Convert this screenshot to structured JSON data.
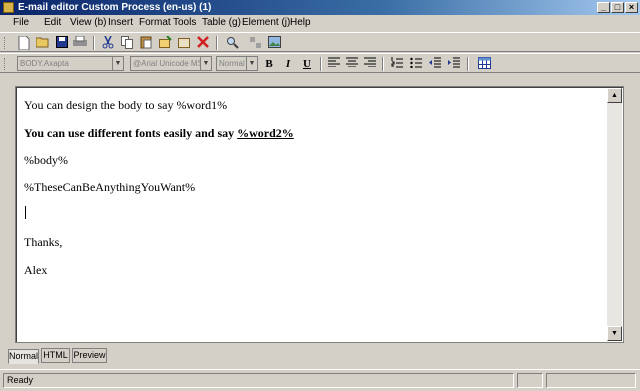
{
  "window": {
    "title": "E-mail editor Custom Process (en-us) (1)",
    "buttons": [
      "_",
      "□",
      "×"
    ]
  },
  "menu": [
    "File",
    "Edit",
    "View (b)",
    "Insert",
    "Format",
    "Tools",
    "Table (g)",
    "Element (j)",
    "Help"
  ],
  "toolbar1": {
    "icons": [
      "new-icon",
      "open-icon",
      "save-icon",
      "print-icon",
      "cut-icon",
      "copy-icon",
      "paste-icon",
      "insert-icon",
      "delete-icon",
      "find-icon",
      "replace-icon",
      "image-icon"
    ]
  },
  "toolbar2": {
    "style_value": "BODY.Axapta",
    "font_value": "@Arial Unicode MS",
    "size_value": "Normal",
    "bold_label": "B",
    "italic_label": "I",
    "underline_label": "U"
  },
  "document": {
    "line1": "You can design the body to say %word1%",
    "line2_text": "You can use different fonts easily and say ",
    "line2_word": "%word2%",
    "line3": "%body%",
    "line4": "%TheseCanBeAnythingYouWant%",
    "line5": "Thanks,",
    "line6": "Alex"
  },
  "tabs": [
    "Normal",
    "HTML",
    "Preview"
  ],
  "status": {
    "text": "Ready"
  }
}
